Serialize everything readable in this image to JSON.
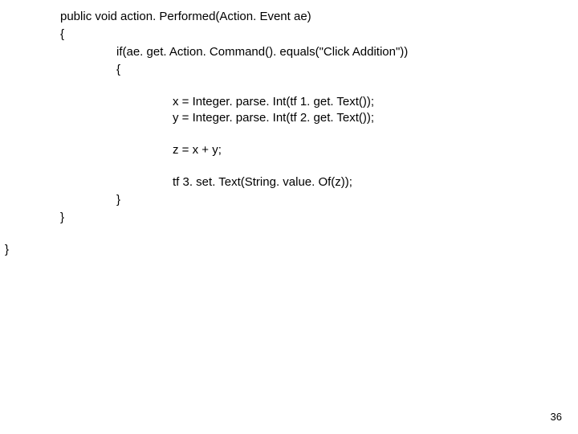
{
  "code": {
    "l1": "public void action. Performed(Action. Event ae)",
    "l2": "{",
    "l3": "if(ae. get. Action. Command(). equals(\"Click Addition\"))",
    "l4": "{",
    "l5": "x = Integer. parse. Int(tf 1. get. Text());",
    "l6": "y = Integer. parse. Int(tf 2. get. Text());",
    "l7": "z = x + y;",
    "l8": "tf 3. set. Text(String. value. Of(z));",
    "l9": "}",
    "l10": "}",
    "l11": "}"
  },
  "page_number": "36"
}
